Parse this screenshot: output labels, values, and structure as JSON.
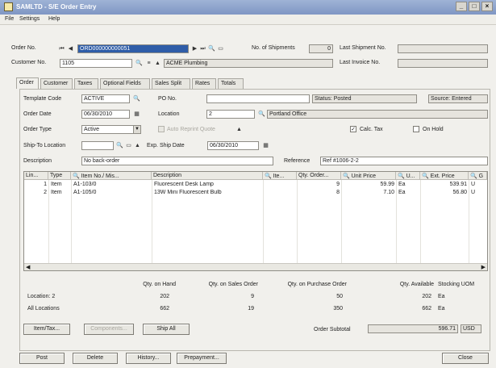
{
  "window": {
    "title": "SAMLTD - S/E Order Entry",
    "controls": [
      "_",
      "□",
      "×"
    ]
  },
  "menu": [
    "File",
    "Settings",
    "Help"
  ],
  "header": {
    "order_no_label": "Order No.",
    "order_no_value": "ORD000000000051",
    "num_shipments_label": "No. of Shipments",
    "num_shipments_value": "0",
    "last_shipment_label": "Last Shipment No.",
    "last_shipment_value": "",
    "customer_no_label": "Customer No.",
    "customer_no_value": "1105",
    "customer_name": "ACME Plumbing",
    "last_invoice_label": "Last Invoice No.",
    "last_invoice_value": ""
  },
  "tabs": [
    "Order",
    "Customer",
    "Taxes",
    "Optional Fields",
    "Sales Split",
    "Rates",
    "Totals"
  ],
  "order": {
    "template_code_label": "Template Code",
    "template_code_value": "ACTIVE",
    "po_no_label": "PO No.",
    "po_no_value": "",
    "status": "Status: Posted",
    "source": "Source: Entered",
    "order_date_label": "Order Date",
    "order_date_value": "06/30/2010",
    "location_label": "Location",
    "location_code": "2",
    "location_name": "Portland Office",
    "order_type_label": "Order Type",
    "order_type_value": "Active",
    "auto_reprint_label": "Auto Reprint Quote",
    "calc_tax_label": "Calc. Tax",
    "on_hold_label": "On Hold",
    "ship_to_label": "Ship-To Location",
    "ship_to_value": "",
    "exp_ship_label": "Exp. Ship Date",
    "exp_ship_value": "06/30/2010",
    "description_label": "Description",
    "description_value": "No back-order",
    "reference_label": "Reference",
    "reference_value": "Ref #1006-2-2"
  },
  "grid": {
    "headers": [
      "Lin...",
      "Type",
      "Item No./ Mis...",
      "Description",
      "Ite...",
      "Qty. Order...",
      "Unit Price",
      "U...",
      "Ext. Price",
      "G"
    ],
    "rows": [
      {
        "line": "1",
        "type": "Item",
        "item": "A1-103/0",
        "description": "Fluorescent Desk Lamp",
        "qty": "9",
        "unit_price": "59.99",
        "uom": "Ea",
        "ext_price": "539.91",
        "g": "U"
      },
      {
        "line": "2",
        "type": "Item",
        "item": "A1-105/0",
        "description": "13W Mini Fluorescent Bulb",
        "qty": "8",
        "unit_price": "7.10",
        "uom": "Ea",
        "ext_price": "56.80",
        "g": "U"
      }
    ]
  },
  "summary": {
    "headers": [
      "Qty. on Hand",
      "Qty. on Sales Order",
      "Qty. on Purchase Order",
      "Qty. Available",
      "Stocking UOM"
    ],
    "rows": [
      {
        "label": "Location: 2",
        "values": [
          "202",
          "9",
          "50",
          "202",
          "Ea"
        ]
      },
      {
        "label": "All Locations",
        "values": [
          "662",
          "19",
          "350",
          "662",
          "Ea"
        ]
      }
    ]
  },
  "actions": {
    "item_tax_label": "Item/Tax...",
    "components_label": "Components...",
    "ship_all_label": "Ship All",
    "subtotal_label": "Order Subtotal",
    "subtotal_value": "596.71",
    "currency": "USD"
  },
  "footer": {
    "post_label": "Post",
    "delete_label": "Delete",
    "history_label": "History...",
    "prepayment_label": "Prepayment...",
    "close_label": "Close"
  }
}
